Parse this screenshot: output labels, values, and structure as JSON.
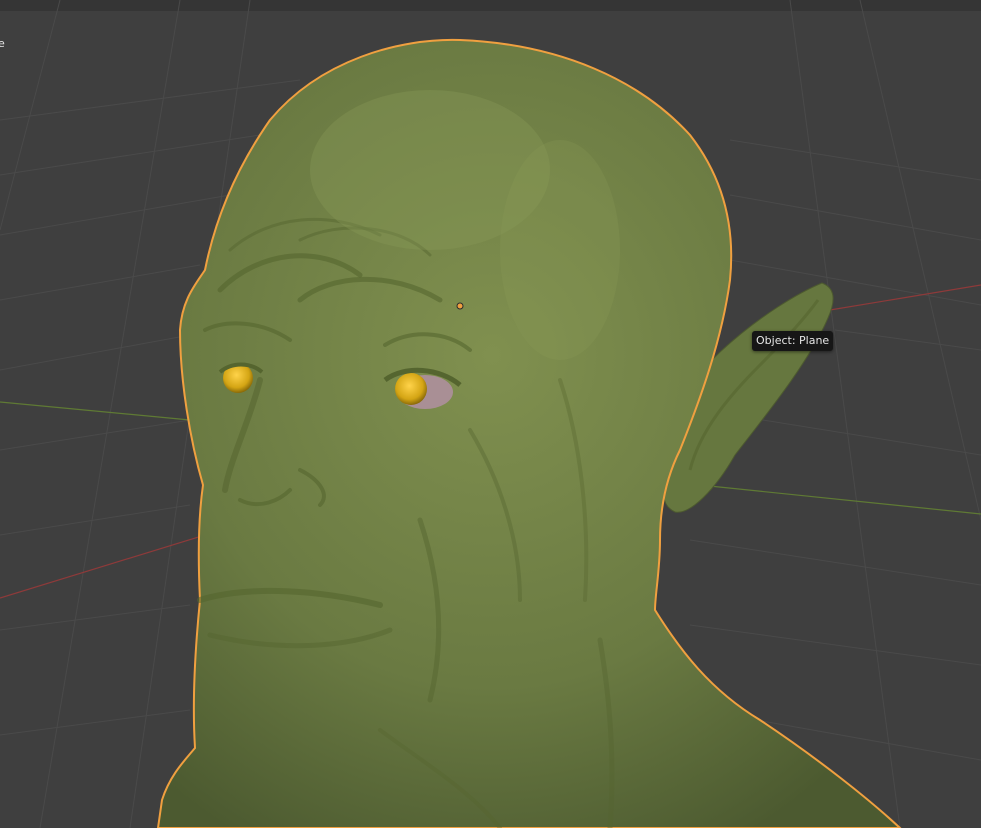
{
  "viewport": {
    "corner_text": "e",
    "tooltip": {
      "prefix": "Object:",
      "name": "Plane"
    }
  },
  "colors": {
    "background": "#3f3f3f",
    "grid_line": "#4b4b4b",
    "x_axis": "#8e3a3a",
    "y_axis": "#5f7a34",
    "selection_outline": "#f0a040",
    "model_skin": "#6d7f45",
    "eye_iris": "#d4a514",
    "origin_dot": "#f0a040"
  },
  "icons": {
    "origin_marker": "origin-dot-icon"
  }
}
